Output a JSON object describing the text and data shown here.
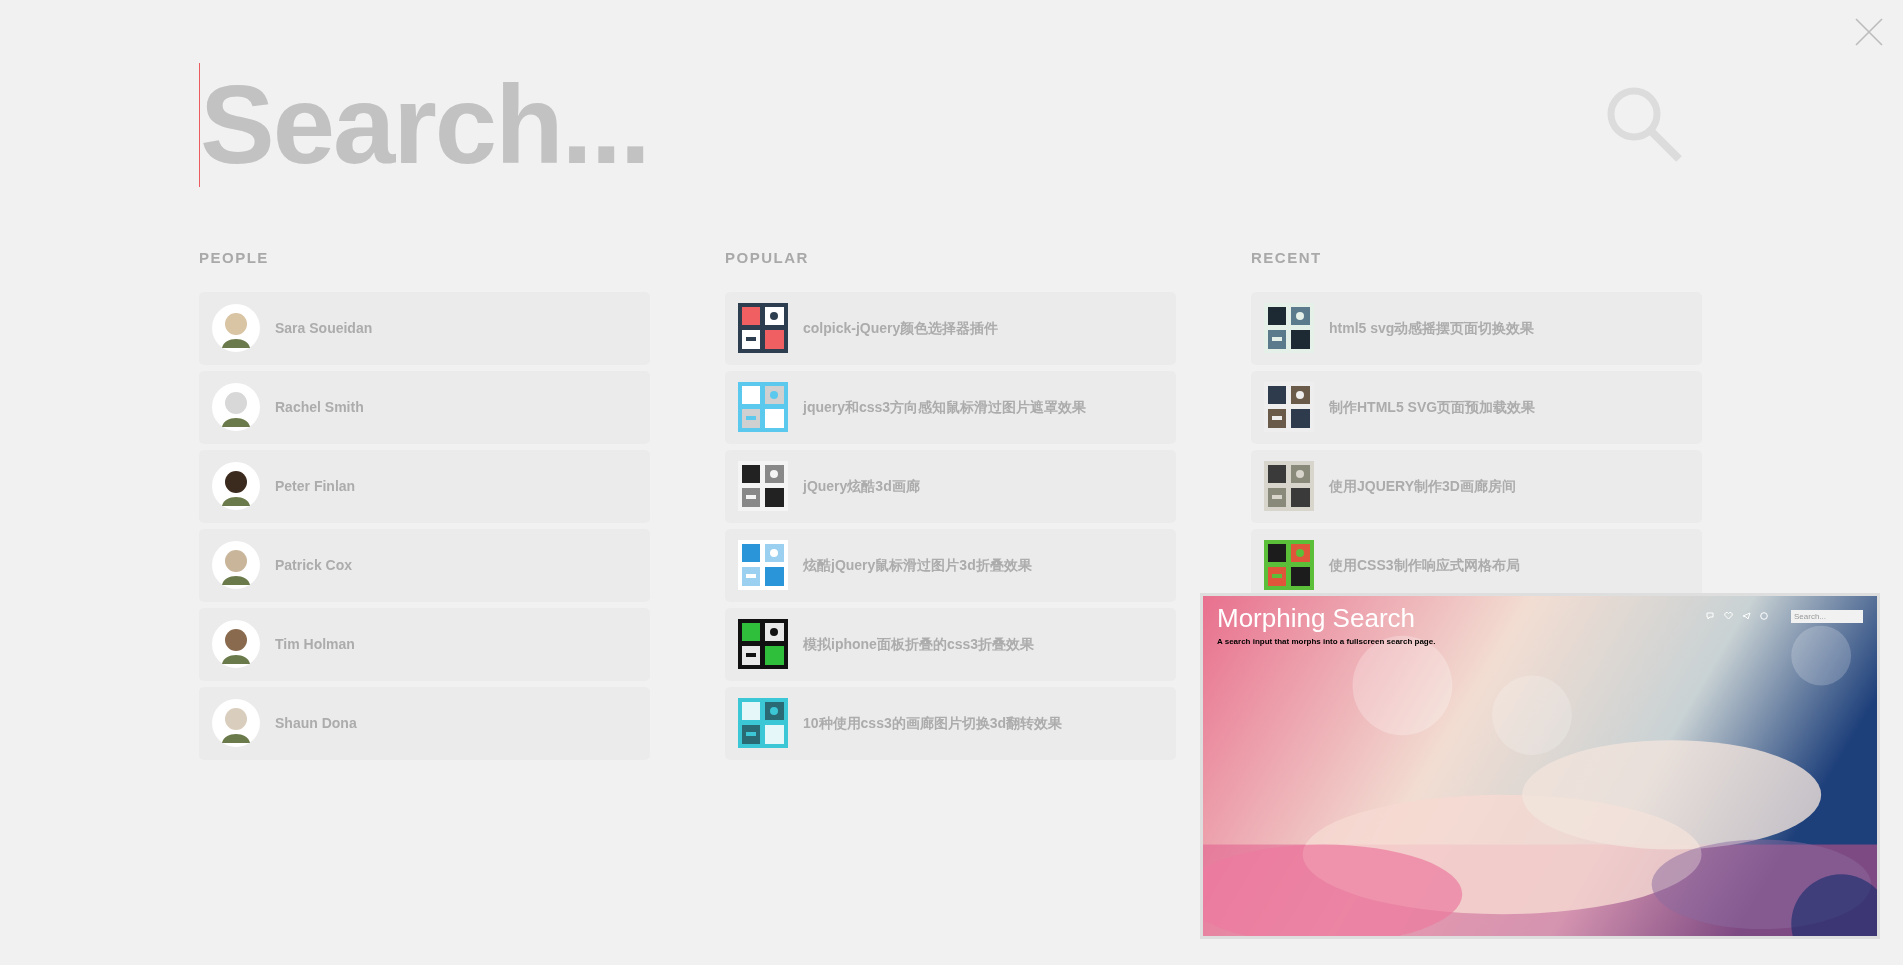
{
  "search": {
    "placeholder": "Search..."
  },
  "sections": [
    {
      "title": "PEOPLE",
      "kind": "people",
      "items": [
        {
          "label": "Sara Soueidan"
        },
        {
          "label": "Rachel Smith"
        },
        {
          "label": "Peter Finlan"
        },
        {
          "label": "Patrick Cox"
        },
        {
          "label": "Tim Holman"
        },
        {
          "label": "Shaun Dona"
        }
      ]
    },
    {
      "title": "POPULAR",
      "kind": "articles",
      "items": [
        {
          "label": "colpick-jQuery颜色选择器插件"
        },
        {
          "label": "jquery和css3方向感知鼠标滑过图片遮罩效果"
        },
        {
          "label": "jQuery炫酷3d画廊"
        },
        {
          "label": "炫酷jQuery鼠标滑过图片3d折叠效果"
        },
        {
          "label": "模拟iphone面板折叠的css3折叠效果"
        },
        {
          "label": "10种使用css3的画廊图片切换3d翻转效果"
        }
      ]
    },
    {
      "title": "RECENT",
      "kind": "articles",
      "items": [
        {
          "label": "html5 svg动感摇摆页面切换效果"
        },
        {
          "label": "制作HTML5 SVG页面预加载效果"
        },
        {
          "label": "使用JQUERY制作3D画廊房间"
        },
        {
          "label": "使用CSS3制作响应式网格布局"
        }
      ]
    }
  ],
  "preview": {
    "title": "Morphing Search",
    "subtitle": "A search input that morphs into a fullscreen search page.",
    "search": {
      "placeholder": "Search..."
    }
  }
}
